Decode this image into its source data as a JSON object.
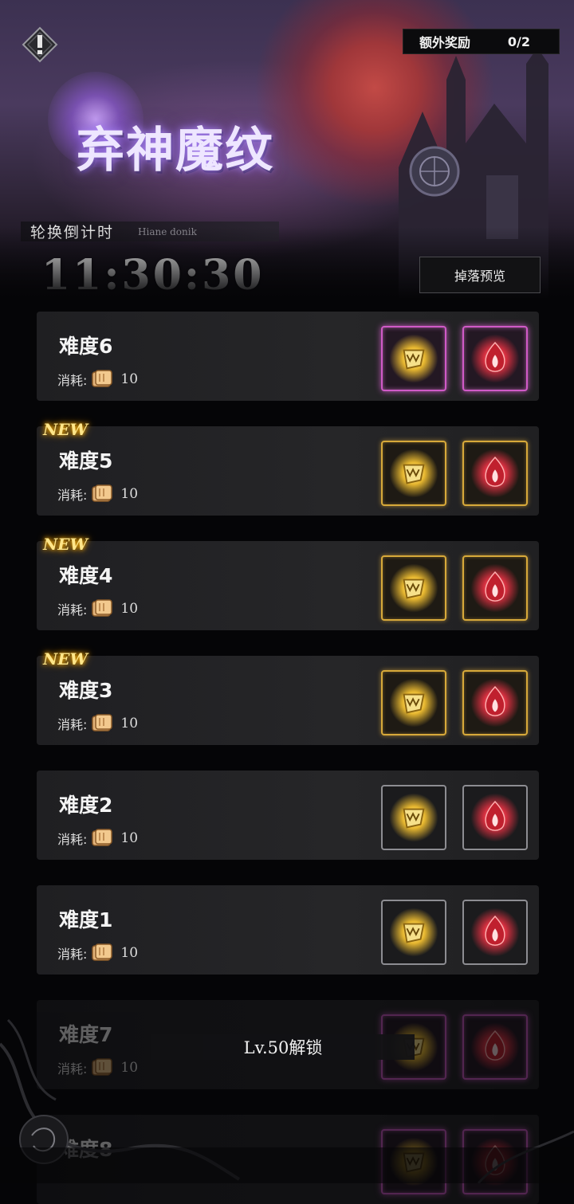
{
  "header": {
    "title": "弃神魔纹",
    "reward_label": "额外奖励",
    "reward_count": "0/2",
    "countdown_label": "轮换倒计时",
    "countdown_sub": "Hiane donik",
    "timer": "11:30:30",
    "drop_preview_label": "掉落预览"
  },
  "list": {
    "cost_label": "消耗:",
    "new_badge": "NEW",
    "items": [
      {
        "name": "难度6",
        "cost": "10",
        "new": false,
        "frame": "pink"
      },
      {
        "name": "难度5",
        "cost": "10",
        "new": true,
        "frame": "gold"
      },
      {
        "name": "难度4",
        "cost": "10",
        "new": true,
        "frame": "gold"
      },
      {
        "name": "难度3",
        "cost": "10",
        "new": true,
        "frame": "gold"
      },
      {
        "name": "难度2",
        "cost": "10",
        "new": false,
        "frame": "silver"
      },
      {
        "name": "难度1",
        "cost": "10",
        "new": false,
        "frame": "silver"
      },
      {
        "name": "难度7",
        "cost": "10",
        "new": false,
        "frame": "pink",
        "locked": true
      },
      {
        "name": "难度8",
        "cost": "",
        "new": false,
        "frame": "pink",
        "locked": true
      }
    ],
    "lock_text": "Lv.50解锁"
  },
  "colors": {
    "pink_frame": "#d05ac7",
    "gold_frame": "#d7a93a",
    "silver_frame": "#8d8d92",
    "new_badge": "#ffe68a"
  },
  "icons": [
    "back-icon",
    "ticket-icon",
    "gold-rune-icon",
    "red-flame-rune-icon"
  ]
}
